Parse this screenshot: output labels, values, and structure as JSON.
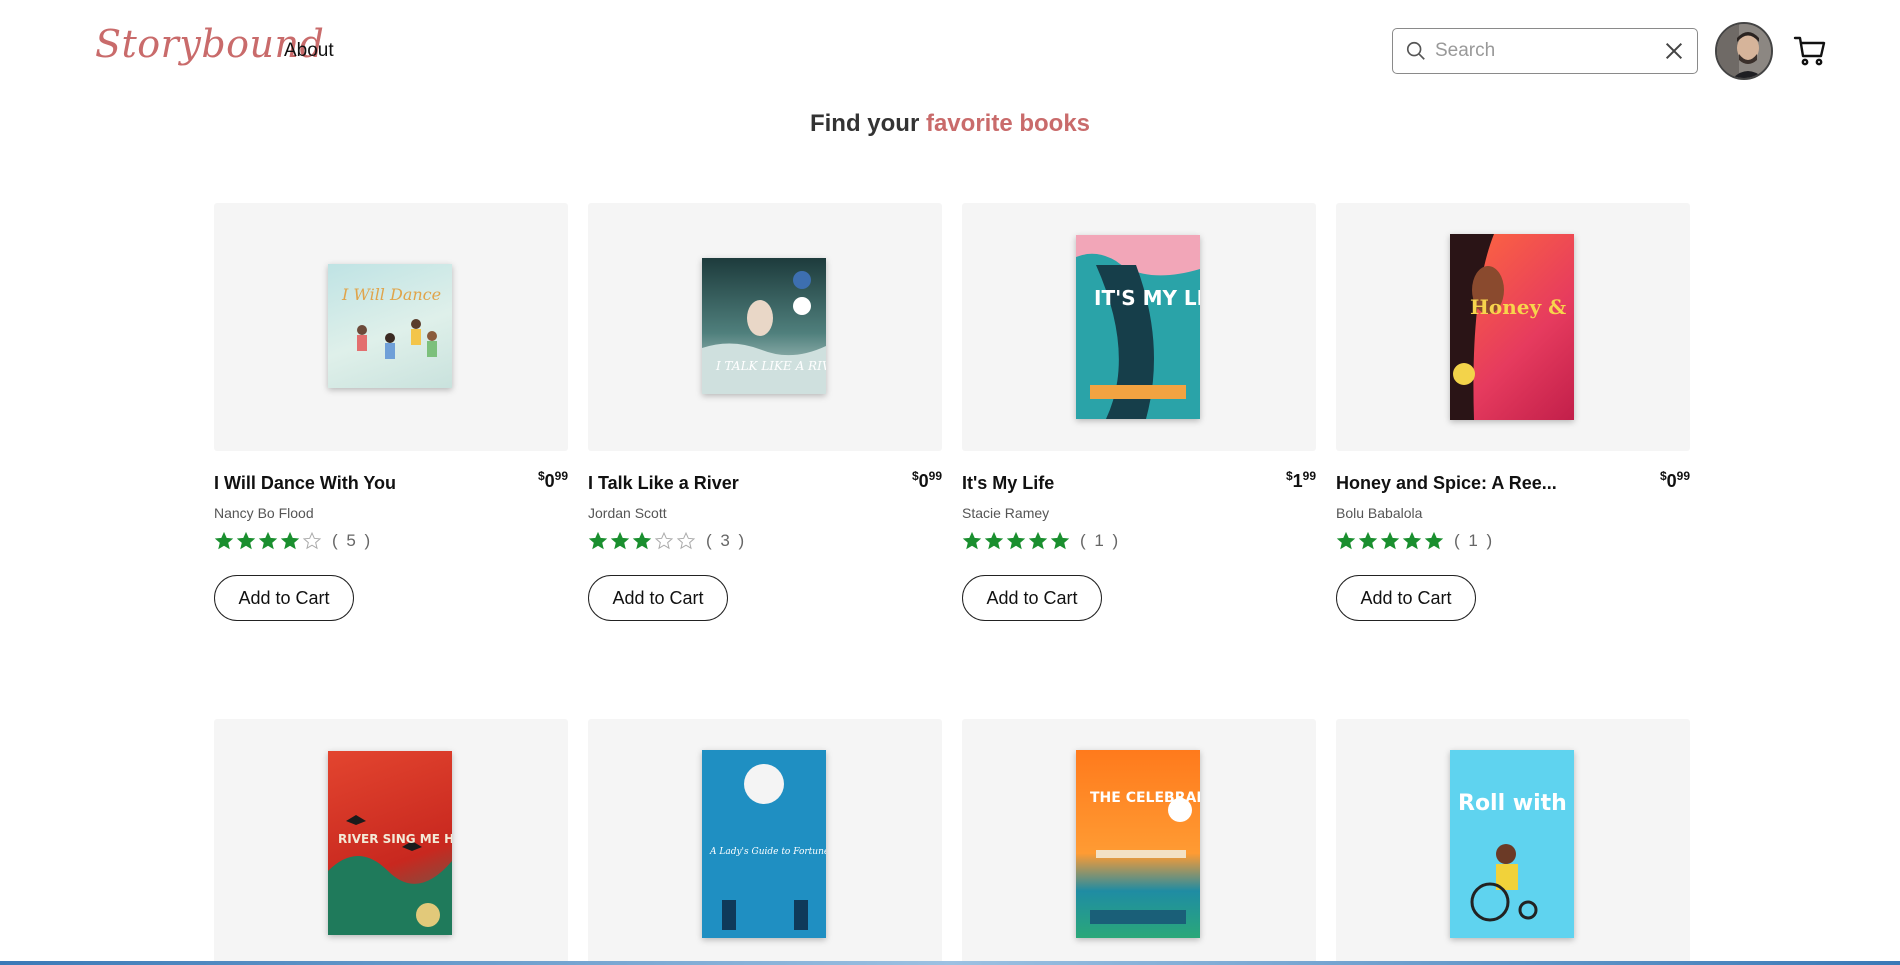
{
  "header": {
    "logo": "Storybound",
    "nav_about": "About",
    "search_placeholder": "Search",
    "search_value": ""
  },
  "tagline": {
    "prefix": "Find your ",
    "accent": "favorite books"
  },
  "add_to_cart_label": "Add to Cart",
  "books": [
    {
      "title": "I Will Dance With You",
      "author": "Nancy Bo Flood",
      "price_whole": "0",
      "price_cents": "99",
      "stars": 4,
      "rating_count": "( 5 )",
      "cover_text": "I Will Dance"
    },
    {
      "title": "I Talk Like a River",
      "author": "Jordan Scott",
      "price_whole": "0",
      "price_cents": "99",
      "stars": 3,
      "rating_count": "( 3 )",
      "cover_text": "I TALK LIKE A RIVER"
    },
    {
      "title": "It's My Life",
      "author": "Stacie Ramey",
      "price_whole": "1",
      "price_cents": "99",
      "stars": 5,
      "rating_count": "( 1 )",
      "cover_text": "IT'S MY LIFE"
    },
    {
      "title": "Honey and Spice: A Ree...",
      "author": "Bolu Babalola",
      "price_whole": "0",
      "price_cents": "99",
      "stars": 5,
      "rating_count": "( 1 )",
      "cover_text": "Honey & Spice"
    },
    {
      "title": "",
      "author": "",
      "cover_text": "RIVER SING ME HOME"
    },
    {
      "title": "",
      "author": "",
      "cover_text": "A Lady's Guide to Fortune-Hunting"
    },
    {
      "title": "",
      "author": "",
      "cover_text": "THE CELEBRANTS"
    },
    {
      "title": "",
      "author": "",
      "cover_text": "Roll with It"
    }
  ],
  "colors": {
    "accent": "#c96b6b",
    "star": "#1a8f2f",
    "card_bg": "#f5f5f5"
  }
}
